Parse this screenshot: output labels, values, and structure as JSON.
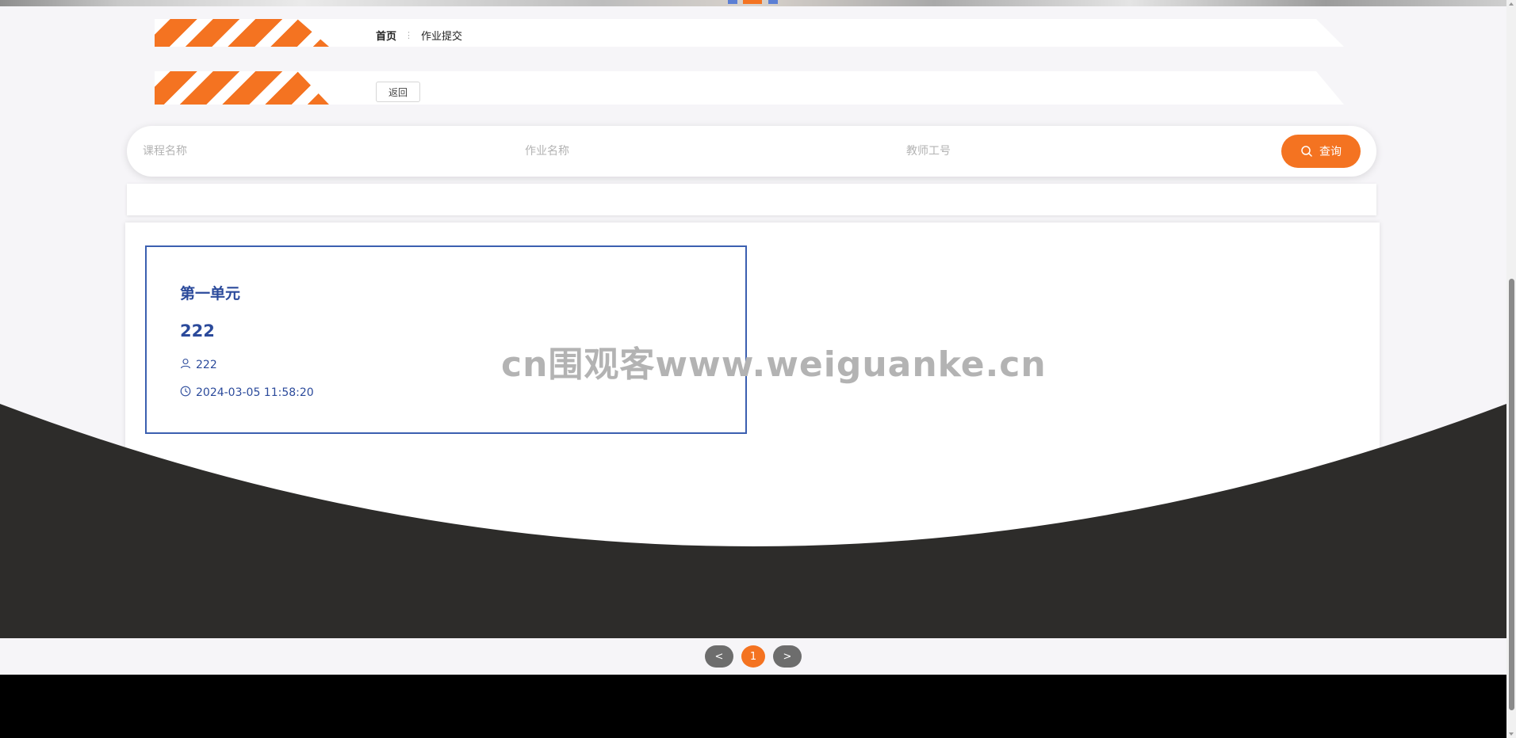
{
  "breadcrumb": {
    "home": "首页",
    "separator": "⋮",
    "current": "作业提交"
  },
  "actions": {
    "back_label": "返回"
  },
  "search": {
    "course_placeholder": "课程名称",
    "homework_placeholder": "作业名称",
    "teacher_placeholder": "教师工号",
    "button_label": "查询"
  },
  "cards": [
    {
      "unit": "第一单元",
      "title": "222",
      "user": "222",
      "time": "2024-03-05 11:58:20"
    }
  ],
  "watermark": "cn围观客www.weiguanke.cn",
  "pagination": {
    "prev": "<",
    "current": "1",
    "next": ">"
  },
  "colors": {
    "accent": "#f47321",
    "card_blue": "#2b4a9b",
    "wave_dark": "#2d2c2a"
  },
  "icons": {
    "user": "user-icon",
    "clock": "clock-icon",
    "search": "search-icon"
  }
}
